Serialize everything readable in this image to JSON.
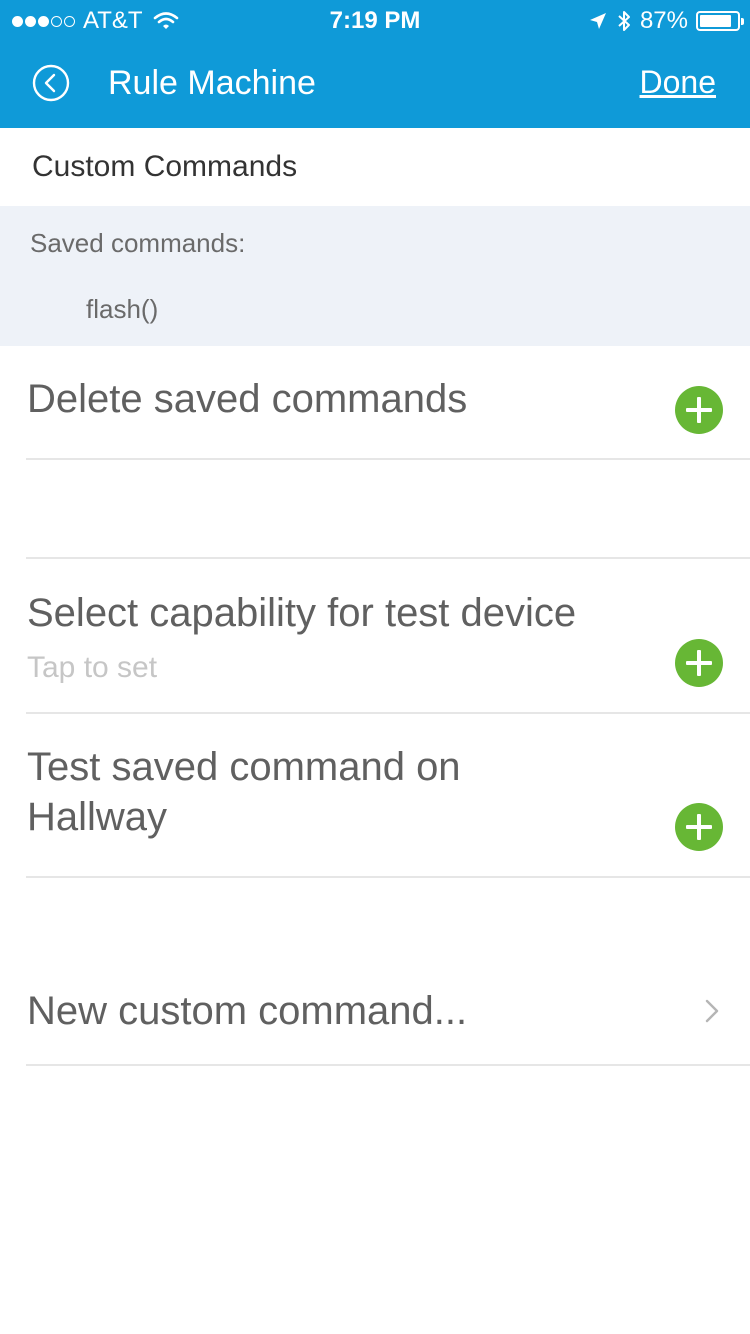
{
  "status_bar": {
    "carrier": "AT&T",
    "time": "7:19 PM",
    "battery_percent": "87%",
    "battery_level": 0.87,
    "signal_bars_filled": 3,
    "signal_bars_total": 5
  },
  "nav": {
    "title": "Rule Machine",
    "done_label": "Done"
  },
  "section": {
    "title": "Custom Commands"
  },
  "saved": {
    "label": "Saved commands:",
    "items": [
      "flash()"
    ]
  },
  "rows": {
    "delete": {
      "title": "Delete saved commands"
    },
    "capability": {
      "title": "Select capability for test device",
      "subtitle": "Tap to set"
    },
    "test": {
      "title_line1": "Test saved command on",
      "title_line2": "Hallway"
    },
    "new_command": {
      "title": "New custom command..."
    }
  },
  "colors": {
    "header": "#0f9ad8",
    "plus_button": "#67b735",
    "saved_background": "#eef2f8"
  }
}
